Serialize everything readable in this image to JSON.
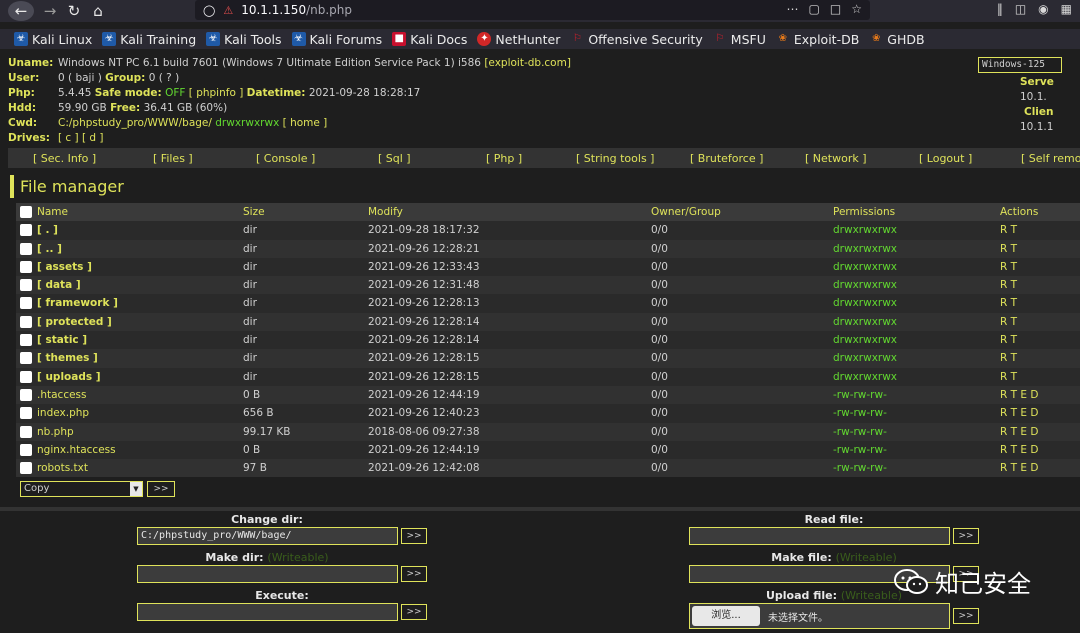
{
  "browser": {
    "url_host": "10.1.1.150",
    "url_path": "/nb.php",
    "bookmarks": [
      {
        "label": "Kali Linux",
        "icon": "kali-icon"
      },
      {
        "label": "Kali Training",
        "icon": "kali-icon"
      },
      {
        "label": "Kali Tools",
        "icon": "kali-icon"
      },
      {
        "label": "Kali Forums",
        "icon": "kali-icon"
      },
      {
        "label": "Kali Docs",
        "icon": "kali-docs-icon"
      },
      {
        "label": "NetHunter",
        "icon": "nethunter-icon"
      },
      {
        "label": "Offensive Security",
        "icon": "offsec-icon"
      },
      {
        "label": "MSFU",
        "icon": "offsec-icon"
      },
      {
        "label": "Exploit-DB",
        "icon": "exploitdb-icon"
      },
      {
        "label": "GHDB",
        "icon": "exploitdb-icon"
      }
    ]
  },
  "info": {
    "uname_label": "Uname:",
    "uname": "Windows NT PC 6.1 build 7601 (Windows 7 Ultimate Edition Service Pack 1) i586",
    "uname_link": "[exploit-db.com]",
    "user_label": "User:",
    "user": "0 ( baji )",
    "group_label": "Group:",
    "group": "0 ( ? )",
    "php_label": "Php:",
    "php": "5.4.45",
    "safe_label": "Safe mode:",
    "safe": "OFF",
    "phpinfo": "[ phpinfo ]",
    "datetime_label": "Datetime:",
    "datetime": "2021-09-28 18:28:17",
    "hdd_label": "Hdd:",
    "hdd": "59.90 GB",
    "free_label": "Free:",
    "free": "36.41 GB (60%)",
    "cwd_label": "Cwd:",
    "cwd": "C:/phpstudy_pro/WWW/bage/",
    "cwd_perm": "drwxrwxrwx",
    "home": "[ home ]",
    "drives_label": "Drives:",
    "drives": "[ c ] [ d ]"
  },
  "server": {
    "select": "Windows-125",
    "serv_label": "Serve",
    "serv_ip": "10.1.",
    "client_label": "Clien",
    "client_ip": "10.1.1"
  },
  "menu": [
    "[ Sec. Info ]",
    "[ Files ]",
    "[ Console ]",
    "[ Sql ]",
    "[ Php ]",
    "[ String tools ]",
    "[ Bruteforce ]",
    "[ Network ]",
    "[ Logout ]",
    "[ Self remov"
  ],
  "fm_title": "File manager",
  "columns": {
    "name": "Name",
    "size": "Size",
    "modify": "Modify",
    "owner": "Owner/Group",
    "perm": "Permissions",
    "actions": "Actions"
  },
  "files": [
    {
      "name": "[ . ]",
      "size": "dir",
      "modify": "2021-09-28 18:17:32",
      "owner": "0/0",
      "perm": "drwxrwxrwx",
      "actions": "R T",
      "dir": true
    },
    {
      "name": "[ .. ]",
      "size": "dir",
      "modify": "2021-09-26 12:28:21",
      "owner": "0/0",
      "perm": "drwxrwxrwx",
      "actions": "R T",
      "dir": true
    },
    {
      "name": "[ assets ]",
      "size": "dir",
      "modify": "2021-09-26 12:33:43",
      "owner": "0/0",
      "perm": "drwxrwxrwx",
      "actions": "R T",
      "dir": true
    },
    {
      "name": "[ data ]",
      "size": "dir",
      "modify": "2021-09-26 12:31:48",
      "owner": "0/0",
      "perm": "drwxrwxrwx",
      "actions": "R T",
      "dir": true
    },
    {
      "name": "[ framework ]",
      "size": "dir",
      "modify": "2021-09-26 12:28:13",
      "owner": "0/0",
      "perm": "drwxrwxrwx",
      "actions": "R T",
      "dir": true
    },
    {
      "name": "[ protected ]",
      "size": "dir",
      "modify": "2021-09-26 12:28:14",
      "owner": "0/0",
      "perm": "drwxrwxrwx",
      "actions": "R T",
      "dir": true
    },
    {
      "name": "[ static ]",
      "size": "dir",
      "modify": "2021-09-26 12:28:14",
      "owner": "0/0",
      "perm": "drwxrwxrwx",
      "actions": "R T",
      "dir": true
    },
    {
      "name": "[ themes ]",
      "size": "dir",
      "modify": "2021-09-26 12:28:15",
      "owner": "0/0",
      "perm": "drwxrwxrwx",
      "actions": "R T",
      "dir": true
    },
    {
      "name": "[ uploads ]",
      "size": "dir",
      "modify": "2021-09-26 12:28:15",
      "owner": "0/0",
      "perm": "drwxrwxrwx",
      "actions": "R T",
      "dir": true
    },
    {
      "name": ".htaccess",
      "size": "0 B",
      "modify": "2021-09-26 12:44:19",
      "owner": "0/0",
      "perm": "-rw-rw-rw-",
      "actions": "R T E D",
      "dir": false
    },
    {
      "name": "index.php",
      "size": "656 B",
      "modify": "2021-09-26 12:40:23",
      "owner": "0/0",
      "perm": "-rw-rw-rw-",
      "actions": "R T E D",
      "dir": false
    },
    {
      "name": "nb.php",
      "size": "99.17 KB",
      "modify": "2018-08-06 09:27:38",
      "owner": "0/0",
      "perm": "-rw-rw-rw-",
      "actions": "R T E D",
      "dir": false
    },
    {
      "name": "nginx.htaccess",
      "size": "0 B",
      "modify": "2021-09-26 12:44:19",
      "owner": "0/0",
      "perm": "-rw-rw-rw-",
      "actions": "R T E D",
      "dir": false
    },
    {
      "name": "robots.txt",
      "size": "97 B",
      "modify": "2021-09-26 12:42:08",
      "owner": "0/0",
      "perm": "-rw-rw-rw-",
      "actions": "R T E D",
      "dir": false
    }
  ],
  "copy_select": "Copy",
  "go": ">>",
  "forms": {
    "change_dir": "Change dir:",
    "change_dir_value": "C:/phpstudy_pro/WWW/bage/",
    "make_dir": "Make dir:",
    "writeable": "(Writeable)",
    "execute": "Execute:",
    "read_file": "Read file:",
    "make_file": "Make file:",
    "upload_file": "Upload file:",
    "browse": "浏览...",
    "no_file": "未选择文件。"
  },
  "watermark": "知己安全"
}
